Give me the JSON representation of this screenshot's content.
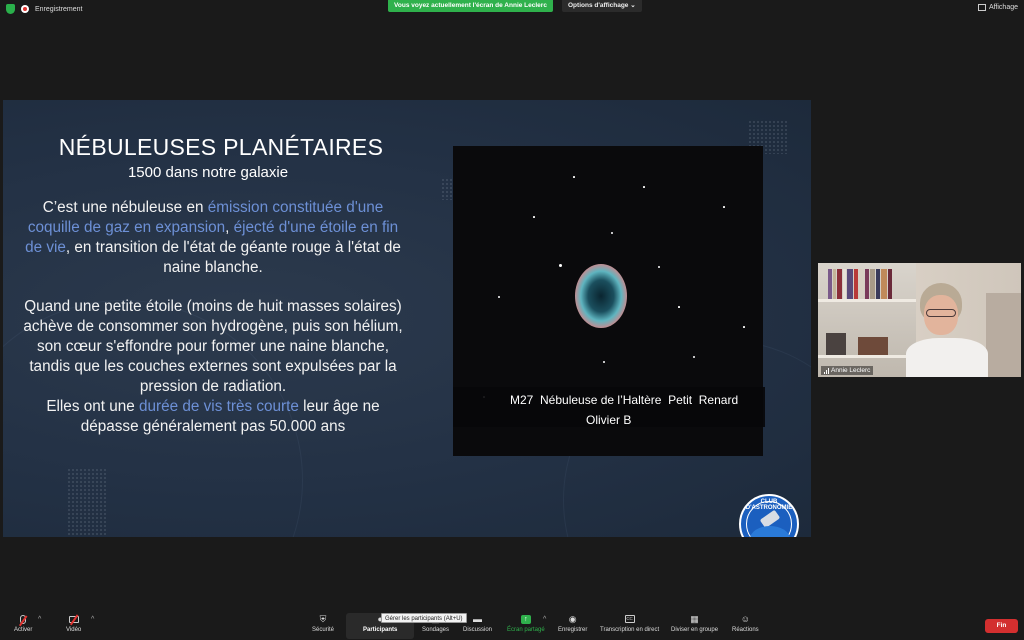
{
  "top_bar": {
    "recording_label": "Enregistrement",
    "share_banner": "Vous voyez actuellement l'écran de Annie Leclerc",
    "view_options": "Options d'affichage ⌄",
    "display_label": "Affichage"
  },
  "slide": {
    "title": "NÉBULEUSES PLANÉTAIRES",
    "subtitle": "1500 dans notre galaxie",
    "p1": {
      "a": "C’est une nébuleuse en ",
      "b": "émission constituée d'une coquille de gaz en expansion",
      "c": ", ",
      "d": "éjecté d'une étoile en fin de vie",
      "e": ", en transition de l'état de géante rouge à l'état de naine blanche."
    },
    "p2": "Quand une petite étoile (moins de huit masses solaires) achève de consommer son hydrogène, puis son hélium, son cœur s'effondre pour former une naine blanche, tandis que les couches externes sont expulsées par la pression de radiation.",
    "p3": {
      "a": "Elles ont une ",
      "b": "durée de vis très courte",
      "c": " leur âge ne dépasse généralement pas 50.000 ans"
    },
    "caption_line1": "M27  Nébuleuse de l’Haltère  Petit  Renard",
    "caption_line2": "Olivier B",
    "logo_text": "CLUB D'ASTRONOMIE",
    "highlight_color": "#6d90d6"
  },
  "participant": {
    "name": "Annie Leclerc"
  },
  "toolbar": {
    "unmute": "Activer",
    "video": "Vidéo",
    "security": "Sécurité",
    "participants": "Participants",
    "polls": "Sondages",
    "chat": "Discussion",
    "share": "Écran partagé",
    "record": "Enregistrer",
    "transcript": "Transcription en direct",
    "breakout": "Diviser en groupe",
    "reactions": "Réactions",
    "end": "Fin",
    "tooltip": "Gérer les participants (Alt+U)",
    "cc_icon_text": "CC",
    "caret": "^"
  },
  "colors": {
    "share_green": "#2fb14c",
    "end_red": "#d32f2f"
  }
}
